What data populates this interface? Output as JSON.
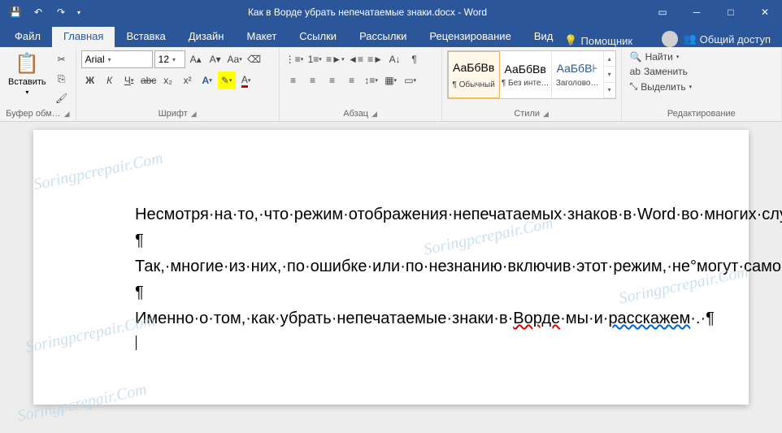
{
  "titlebar": {
    "title": "Как в Ворде убрать непечатаемые знаки.docx - Word",
    "save_icon": "💾",
    "undo_icon": "↶",
    "redo_icon": "↷",
    "qat_more": "▾",
    "min": "─",
    "restore": "▭",
    "max": "□",
    "close": "✕"
  },
  "tabs": {
    "file": "Файл",
    "home": "Главная",
    "insert": "Вставка",
    "design": "Дизайн",
    "layout": "Макет",
    "references": "Ссылки",
    "mailings": "Рассылки",
    "review": "Рецензирование",
    "view": "Вид",
    "assistant_icon": "💡",
    "assistant": "Помощник",
    "share_icon": "👥",
    "share": "Общий доступ"
  },
  "ribbon": {
    "clipboard": {
      "paste_label": "Вставить",
      "group_label": "Буфер обм…",
      "cut": "✂",
      "copy": "⎘",
      "fmt": "🖌",
      "paste_icon": "📋"
    },
    "font": {
      "name": "Arial",
      "size": "12",
      "grow": "A▴",
      "shrink": "A▾",
      "case": "Aa",
      "clear": "⌫",
      "bold": "Ж",
      "italic": "К",
      "under": "Ч",
      "strike": "abc",
      "sub": "x₂",
      "sup": "x²",
      "effects": "A",
      "hl": "✎",
      "color": "A",
      "group_label": "Шрифт"
    },
    "para": {
      "group_label": "Абзац",
      "bul": "⋮≡",
      "num": "1≡",
      "ml": "≡►",
      "dec": "◄≡",
      "inc": "≡►",
      "sort": "A↓",
      "pil": "¶",
      "al": "≡",
      "ac": "≡",
      "ar": "≡",
      "aj": "≡",
      "ls": "↕≡",
      "shade": "▦",
      "border": "▭"
    },
    "styles": {
      "group_label": "Стили",
      "s1_prev": "АаБбВв",
      "s1_name": "¶ Обычный",
      "s2_prev": "АаБбВв",
      "s2_name": "¶ Без инте…",
      "s3_prev": "АаБбВ⊦",
      "s3_name": "Заголово…"
    },
    "editing": {
      "group_label": "Редактирование",
      "find_icon": "🔍",
      "find": "Найти",
      "replace_icon": "ab",
      "replace": "Заменить",
      "select_icon": "⤡",
      "select": "Выделить"
    }
  },
  "doc": {
    "p1": "Несмотря·на·то,·что·режим·отображения·непечатаемых·знаков·в·Word·во·многих·случаях·является·очень·полезным,·для·некоторых·пользователей·он·выливается·в·серьезную·проблему.·¶",
    "p2": "¶",
    "p3": "Так,·многие·из·них,·по·ошибке·или·по·незнанию·включив·этот·режим,·не°могут·самостоятельно·разобраться·с·тем,·как·его·отключить.·¶",
    "p4": "¶",
    "p5a": "Именно·о·том,·как·убрать·непечатаемые·знаки·в·",
    "p5b": "Ворде",
    "p5c": "·мы·и·",
    "p5d": "расскажем",
    "p5e": "·.·¶"
  },
  "watermark": "Soringpcrepair.Com"
}
